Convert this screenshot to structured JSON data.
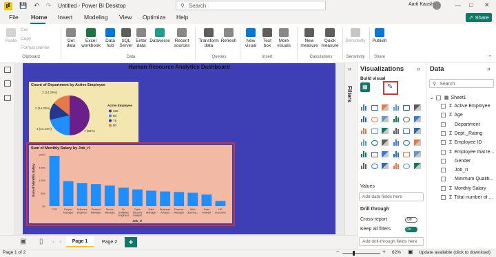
{
  "app": {
    "title": "Untitled - Power BI Desktop",
    "search_placeholder": "Search",
    "user": "Aarti Kaushik"
  },
  "menu": {
    "tabs": [
      "File",
      "Home",
      "Insert",
      "Modeling",
      "View",
      "Optimize",
      "Help"
    ],
    "share_label": "Share"
  },
  "ribbon": {
    "clipboard": {
      "paste": "Paste",
      "cut": "Cut",
      "copy": "Copy",
      "format_painter": "Format painter",
      "group": "Clipboard"
    },
    "data": {
      "get_data": "Get data",
      "excel": "Excel workbook",
      "data_hub": "Data hub",
      "sql": "SQL Server",
      "enter_data": "Enter data",
      "dataverse": "Dataverse",
      "recent": "Recent sources",
      "group": "Data"
    },
    "queries": {
      "transform": "Transform data",
      "refresh": "Refresh",
      "group": "Queries"
    },
    "insert": {
      "new_visual": "New visual",
      "text_box": "Text box",
      "more_visuals": "More visuals",
      "group": "Insert"
    },
    "calculations": {
      "new_measure": "New measure",
      "quick_measure": "Quick measure",
      "group": "Calculations"
    },
    "sensitivity": {
      "label": "Sensitivity",
      "group": "Sensitivity"
    },
    "share": {
      "publish": "Publish",
      "group": "Share"
    }
  },
  "report": {
    "title": "Human Resource Analytics Dashboard",
    "pie": {
      "title": "Count of Department by Active Employee",
      "legend_title": "Active Employee",
      "legend_items": [
        "100",
        "50",
        "75",
        "80"
      ],
      "labels": [
        "2 (14.29%)",
        "2 (14.29%)",
        "3 (21.43%)",
        "7 (50%)"
      ]
    },
    "bar": {
      "title": "Sum of Monthly Salary by Job_rl"
    }
  },
  "chart_data": [
    {
      "type": "pie",
      "title": "Count of Department by Active Employee",
      "legend_title": "Active Employee",
      "series": [
        {
          "name": "100",
          "value": 7,
          "label": "7 (50%)",
          "color": "#6b1f8a"
        },
        {
          "name": "50",
          "value": 3,
          "label": "3 (21.43%)",
          "color": "#1f8fff"
        },
        {
          "name": "75",
          "value": 2,
          "label": "2 (14.29%)",
          "color": "#233a8c"
        },
        {
          "name": "80",
          "value": 2,
          "label": "2 (14.29%)",
          "color": "#e8774a"
        }
      ]
    },
    {
      "type": "bar",
      "title": "Sum of Monthly Salary by Job_rl",
      "xlabel": "Job_rl",
      "ylabel": "Sum of Monthly Salary",
      "yticks": [
        "0K",
        "50K",
        "100K",
        "150K",
        "200K"
      ],
      "ylim": [
        0,
        200
      ],
      "color": "#1f8fff",
      "categories": [
        "CTO",
        "Project Manager",
        "Software Engineer",
        "Product Manager",
        "Senior Manager",
        "Sr. Software Engineer",
        "Cyber Security Analyst",
        "Data Manager",
        "Business Analyst",
        "Finance Manager",
        "Web develop...",
        "Data Analyst",
        "HR executive"
      ],
      "values": [
        195,
        97,
        90,
        85,
        80,
        72,
        65,
        60,
        57,
        55,
        52,
        45,
        20
      ]
    }
  ],
  "viz_pane": {
    "title": "Visualizations",
    "build_visual": "Build visual",
    "values_label": "Values",
    "values_placeholder": "Add data fields here",
    "drillthrough_label": "Drill through",
    "cross_report": "Cross-report",
    "cross_report_state": "Off",
    "keep_filters": "Keep all filters",
    "keep_filters_state": "On",
    "drillthrough_placeholder": "Add drill-through fields here"
  },
  "filters_label": "Filters",
  "data_pane": {
    "title": "Data",
    "search_placeholder": "Search",
    "table": "Sheet1",
    "fields": [
      {
        "name": "Active Employee",
        "sigma": true
      },
      {
        "name": "Age",
        "sigma": true
      },
      {
        "name": "Department",
        "sigma": false
      },
      {
        "name": "Dept._Rating",
        "sigma": true
      },
      {
        "name": "Employee ID",
        "sigma": true
      },
      {
        "name": "Employee that le...",
        "sigma": true
      },
      {
        "name": "Gender",
        "sigma": false
      },
      {
        "name": "Job_rl",
        "sigma": false
      },
      {
        "name": "Minimum Qualifi...",
        "sigma": false
      },
      {
        "name": "Monthly Salary",
        "sigma": true
      },
      {
        "name": "Total number of ...",
        "sigma": true
      }
    ]
  },
  "pages": {
    "tabs": [
      "Page 1",
      "Page 2"
    ],
    "add": "+"
  },
  "status": {
    "page_indicator": "Page 1 of 2",
    "zoom": "62%",
    "update": "Update available (click to download)"
  }
}
